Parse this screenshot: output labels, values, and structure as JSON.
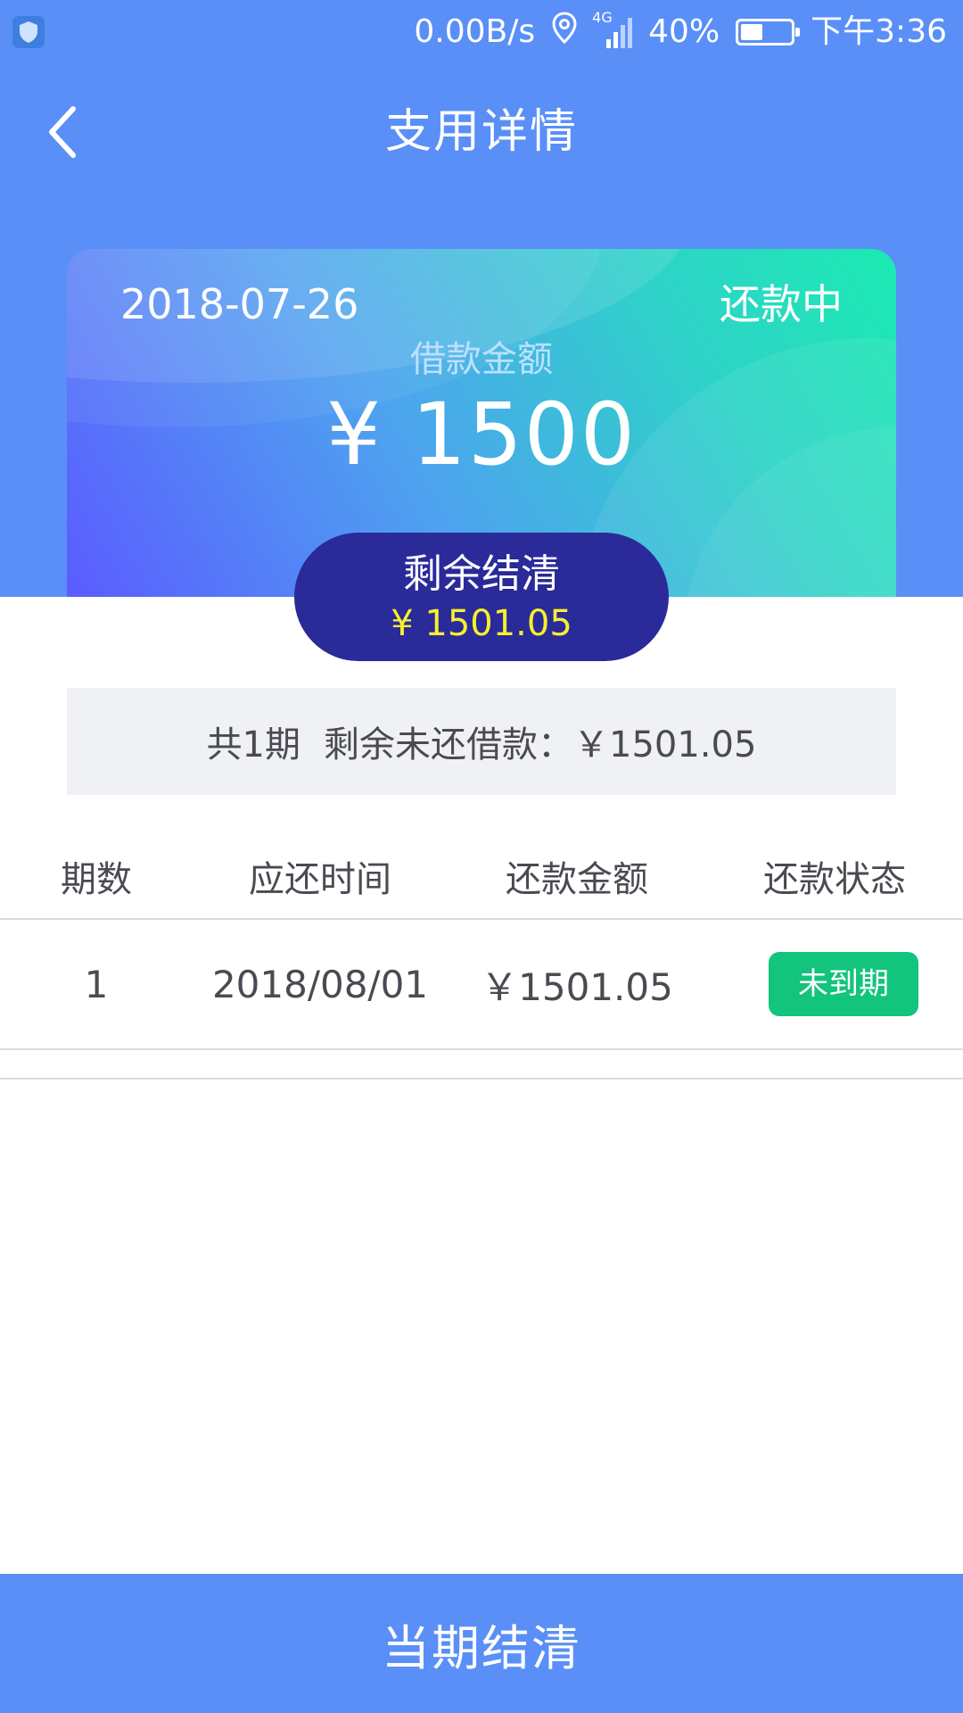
{
  "status_bar": {
    "speed": "0.00B/s",
    "network": "4G",
    "battery": "40%",
    "time": "下午3:36"
  },
  "nav": {
    "title": "支用详情"
  },
  "card": {
    "date": "2018-07-26",
    "status": "还款中",
    "amount_label": "借款金额",
    "amount": "¥ 1500"
  },
  "payoff": {
    "label": "剩余结清",
    "amount": "¥ 1501.05"
  },
  "summary": {
    "periods": "共1期",
    "remaining": "剩余未还借款：￥1501.05"
  },
  "table": {
    "headers": [
      "期数",
      "应还时间",
      "还款金额",
      "还款状态"
    ],
    "rows": [
      {
        "period": "1",
        "due_date": "2018/08/01",
        "amount": "￥1501.05",
        "status": "未到期"
      }
    ]
  },
  "bottom_button": {
    "label": "当期结清"
  },
  "colors": {
    "primary": "#5a8ff8",
    "pill_bg": "#2a2a99",
    "pill_amount": "#f7f02c",
    "status_green": "#12c47c"
  }
}
